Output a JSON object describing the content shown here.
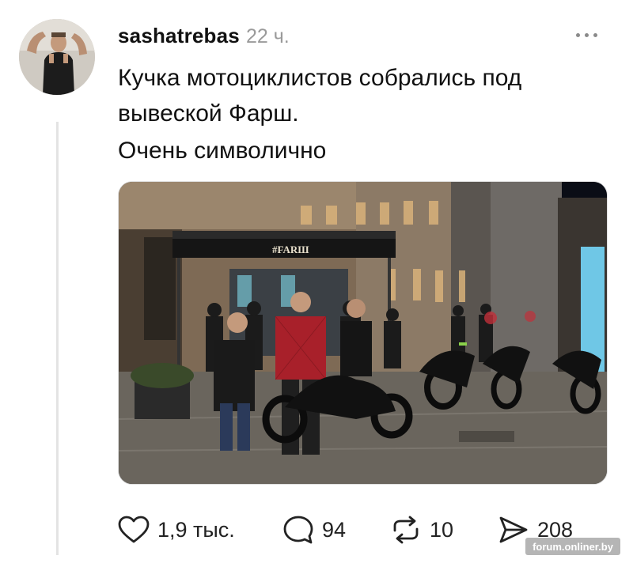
{
  "post": {
    "username": "sashatrebas",
    "time": "22 ч.",
    "lines": [
      "Кучка мотоциклистов собрались под",
      "вывеской Фарш.",
      "Очень символично"
    ],
    "photo_sign": "#FARШ"
  },
  "actions": {
    "likes": "1,9 тыс.",
    "comments": "94",
    "reposts": "10",
    "shares": "208"
  },
  "watermark": "forum.onliner.by",
  "icons": [
    "heart-icon",
    "comment-icon",
    "repost-icon",
    "share-icon",
    "more-icon"
  ]
}
